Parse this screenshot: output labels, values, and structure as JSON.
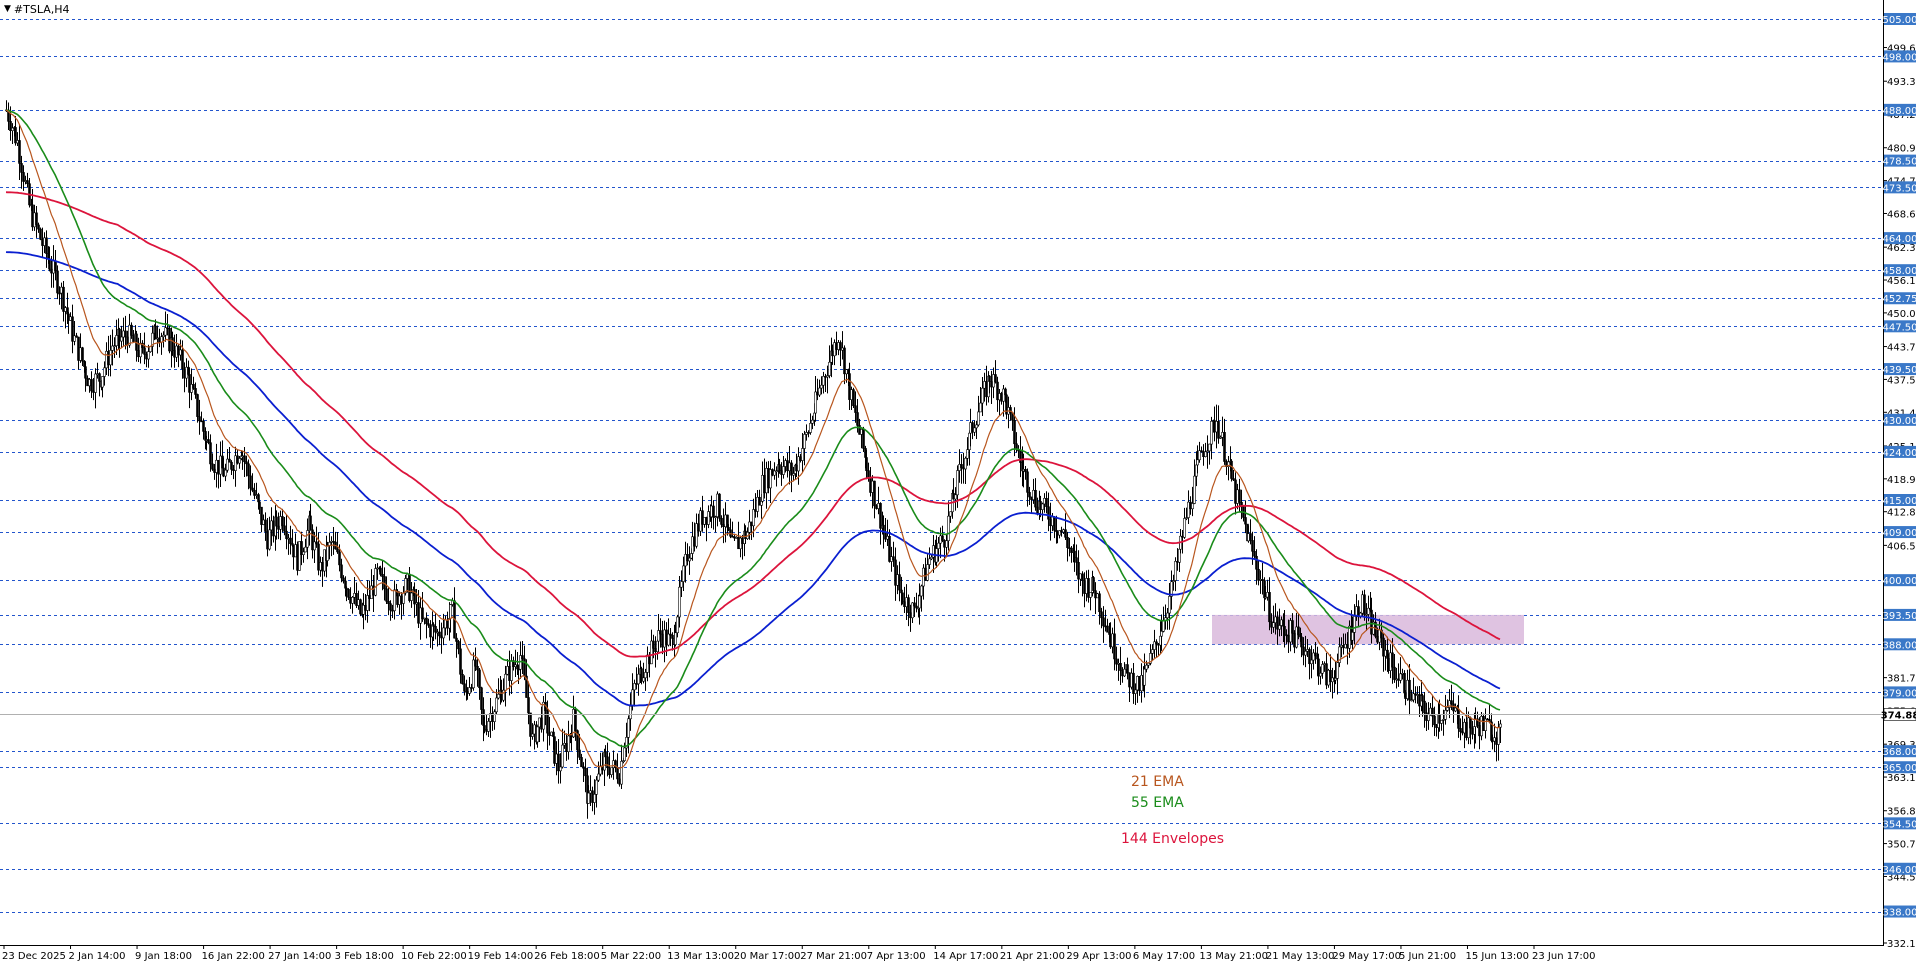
{
  "header": {
    "symbol_label": "#TSLA,H4"
  },
  "colors": {
    "ema21": "#b8561e",
    "ema55": "#1a8c1a",
    "envelope_upper": "#dc143c",
    "envelope_lower": "#0a1fd0",
    "level_line": "#2255cc",
    "level_badge": "#3a78c8",
    "zone": "#d9b8dc",
    "candle": "#000000",
    "grid": "#000000"
  },
  "legend": {
    "ema21_label": "21 EMA",
    "ema55_label": "55 EMA",
    "envelope_label": "144 Envelopes"
  },
  "chart_data": {
    "type": "candlestick",
    "title": "#TSLA,H4",
    "ylim": [
      332.11,
      507.5
    ],
    "price_axis_ticks": [
      "505.00",
      "499.66",
      "493.36",
      "487.21",
      "480.91",
      "474.76",
      "468.61",
      "462.31",
      "456.16",
      "450.01",
      "443.71",
      "437.56",
      "431.41",
      "425.11",
      "418.96",
      "412.81",
      "406.51",
      "400.36",
      "393.61",
      "387.91",
      "381.76",
      "375.61",
      "369.31",
      "363.16",
      "356.86",
      "350.71",
      "344.56",
      "338.26",
      "332.11"
    ],
    "time_axis_labels": [
      "23 Dec 2025",
      "2 Jan 14:00",
      "9 Jan 18:00",
      "16 Jan 22:00",
      "27 Jan 14:00",
      "3 Feb 18:00",
      "10 Feb 22:00",
      "19 Feb 14:00",
      "26 Feb 18:00",
      "5 Mar 22:00",
      "13 Mar 13:00",
      "20 Mar 17:00",
      "27 Mar 21:00",
      "7 Apr 13:00",
      "14 Apr 17:00",
      "21 Apr 21:00",
      "29 Apr 13:00",
      "6 May 17:00",
      "13 May 21:00",
      "21 May 13:00",
      "29 May 17:00",
      "5 Jun 21:00",
      "15 Jun 13:00",
      "23 Jun 17:00"
    ],
    "horizontal_levels": [
      "505.00",
      "498.00",
      "488.00",
      "478.50",
      "473.50",
      "464.00",
      "458.00",
      "452.75",
      "447.50",
      "439.50",
      "430.00",
      "424.00",
      "415.00",
      "409.00",
      "400.00",
      "393.50",
      "388.00",
      "379.00",
      "368.00",
      "365.00",
      "354.50",
      "346.00",
      "338.00"
    ],
    "current_price": "374.88",
    "zone": {
      "from_price": 388.0,
      "to_price": 393.5,
      "from_label": "29 May 17:00",
      "to_label": "23 Jun 17:00"
    },
    "close_path": [
      [
        0,
        488
      ],
      [
        6,
        482
      ],
      [
        12,
        470
      ],
      [
        20,
        462
      ],
      [
        28,
        455
      ],
      [
        36,
        445
      ],
      [
        44,
        437
      ],
      [
        50,
        438
      ],
      [
        56,
        444
      ],
      [
        64,
        446
      ],
      [
        72,
        442
      ],
      [
        80,
        447
      ],
      [
        88,
        444
      ],
      [
        96,
        438
      ],
      [
        104,
        428
      ],
      [
        110,
        422
      ],
      [
        116,
        420
      ],
      [
        124,
        425
      ],
      [
        130,
        417
      ],
      [
        138,
        408
      ],
      [
        146,
        412
      ],
      [
        154,
        404
      ],
      [
        160,
        410
      ],
      [
        166,
        402
      ],
      [
        172,
        407
      ],
      [
        180,
        399
      ],
      [
        188,
        393
      ],
      [
        196,
        401
      ],
      [
        204,
        396
      ],
      [
        212,
        399
      ],
      [
        220,
        392
      ],
      [
        228,
        390
      ],
      [
        236,
        394
      ],
      [
        242,
        378
      ],
      [
        248,
        384
      ],
      [
        252,
        372
      ],
      [
        260,
        378
      ],
      [
        266,
        383
      ],
      [
        272,
        386
      ],
      [
        278,
        370
      ],
      [
        284,
        375
      ],
      [
        292,
        365
      ],
      [
        300,
        374
      ],
      [
        308,
        358
      ],
      [
        316,
        366
      ],
      [
        324,
        364
      ],
      [
        332,
        380
      ],
      [
        340,
        386
      ],
      [
        346,
        390
      ],
      [
        352,
        388
      ],
      [
        360,
        405
      ],
      [
        368,
        412
      ],
      [
        376,
        414
      ],
      [
        384,
        406
      ],
      [
        392,
        409
      ],
      [
        400,
        418
      ],
      [
        408,
        422
      ],
      [
        416,
        420
      ],
      [
        424,
        428
      ],
      [
        432,
        438
      ],
      [
        440,
        446
      ],
      [
        448,
        432
      ],
      [
        456,
        420
      ],
      [
        464,
        409
      ],
      [
        472,
        398
      ],
      [
        480,
        394
      ],
      [
        488,
        404
      ],
      [
        496,
        408
      ],
      [
        504,
        420
      ],
      [
        512,
        430
      ],
      [
        520,
        438
      ],
      [
        528,
        434
      ],
      [
        536,
        422
      ],
      [
        544,
        415
      ],
      [
        552,
        412
      ],
      [
        560,
        408
      ],
      [
        568,
        400
      ],
      [
        576,
        398
      ],
      [
        584,
        389
      ],
      [
        592,
        382
      ],
      [
        600,
        380
      ],
      [
        608,
        388
      ],
      [
        616,
        398
      ],
      [
        624,
        412
      ],
      [
        632,
        424
      ],
      [
        640,
        430
      ],
      [
        650,
        416
      ],
      [
        660,
        404
      ],
      [
        670,
        392
      ],
      [
        680,
        390
      ],
      [
        690,
        386
      ],
      [
        700,
        381
      ],
      [
        708,
        388
      ],
      [
        716,
        396
      ],
      [
        724,
        390
      ],
      [
        734,
        383
      ],
      [
        744,
        378
      ],
      [
        754,
        374
      ],
      [
        764,
        376
      ],
      [
        772,
        372
      ],
      [
        780,
        373
      ],
      [
        790,
        371
      ]
    ],
    "series": [
      {
        "name": "21 EMA"
      },
      {
        "name": "55 EMA"
      },
      {
        "name": "144 Envelopes"
      }
    ]
  }
}
